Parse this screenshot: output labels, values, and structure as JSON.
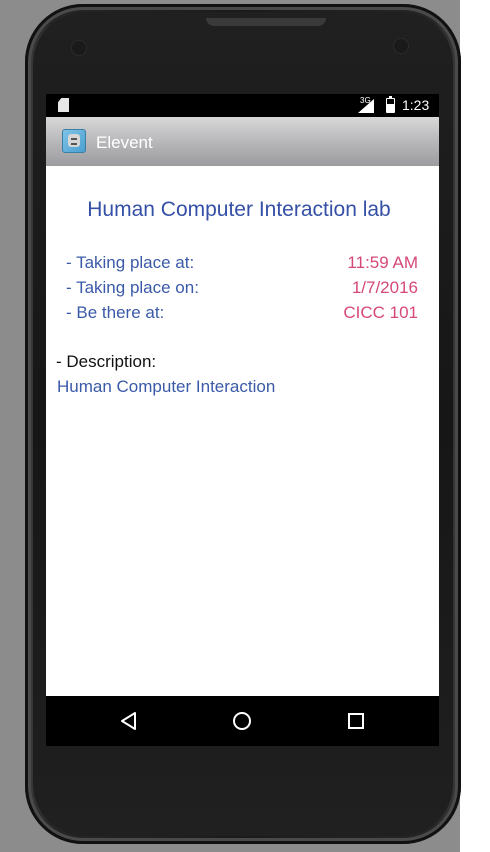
{
  "status_bar": {
    "time": "1:23",
    "network": "3G",
    "icons": [
      "sd-card-icon",
      "signal-icon",
      "battery-charging-icon"
    ],
    "battery_level": 0.6
  },
  "action_bar": {
    "app_icon": "robot-app-icon",
    "title": "Elevent"
  },
  "event": {
    "title": "Human Computer Interaction lab",
    "details": [
      {
        "label": "- Taking place at:",
        "value": "11:59 AM"
      },
      {
        "label": "- Taking place on:",
        "value": "1/7/2016"
      },
      {
        "label": "- Be there at:",
        "value": "CICC 101"
      }
    ],
    "description_label": "- Description:",
    "description": "Human Computer Interaction"
  },
  "nav_bar": {
    "icons": [
      "back-icon",
      "home-icon",
      "recents-icon"
    ]
  },
  "colors": {
    "title_blue": "#3550a6",
    "label_blue": "#3a5aa8",
    "value_pink": "#d6477a"
  }
}
